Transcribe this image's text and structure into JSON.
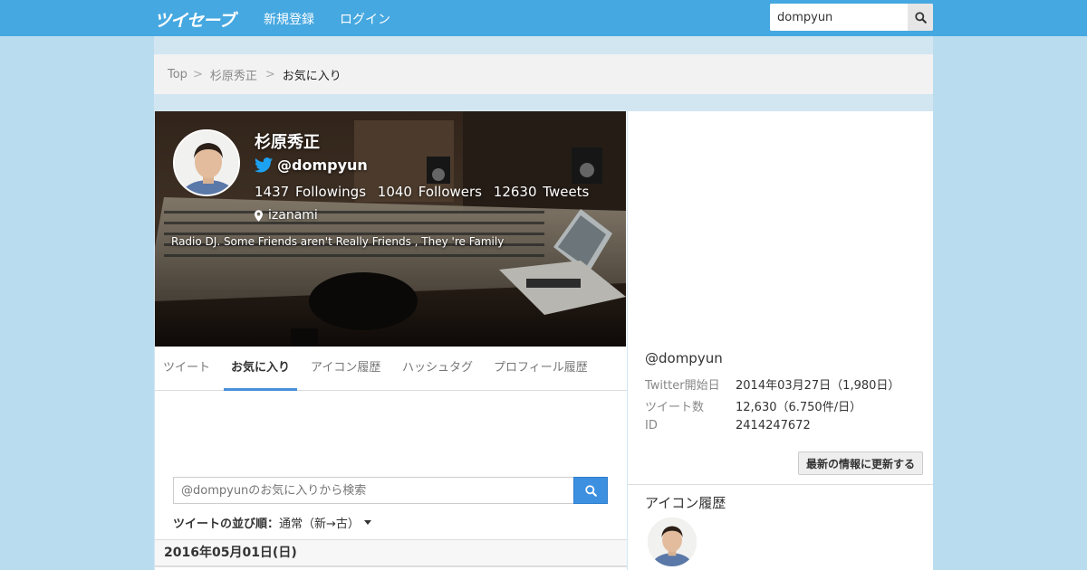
{
  "header": {
    "logo": "ツイセーブ",
    "nav": {
      "signup": "新規登録",
      "login": "ログイン"
    },
    "search": {
      "value": "dompyun"
    }
  },
  "breadcrumb": {
    "items": [
      "Top",
      "杉原秀正"
    ],
    "separator": ">",
    "current": "お気に入り"
  },
  "profile": {
    "name": "杉原秀正",
    "handle": "@dompyun",
    "followings": "1437 Followings",
    "followers": "1040 Followers",
    "tweets": "12630 Tweets",
    "location": "izanami",
    "bio": "Radio DJ. Some Friends aren't Really Friends , They 're Family"
  },
  "tabs": [
    {
      "label": "ツイート"
    },
    {
      "label": "お気に入り"
    },
    {
      "label": "アイコン履歴"
    },
    {
      "label": "ハッシュタグ"
    },
    {
      "label": "プロフィール履歴"
    }
  ],
  "favorites": {
    "search_placeholder": "@dompyunのお気に入りから検索",
    "sort_label": "ツイートの並び順：",
    "sort_value": "通常（新→古）",
    "date_header": "2016年05月01日(日)"
  },
  "sidebar": {
    "handle": "@dompyun",
    "info": [
      {
        "label": "Twitter開始日",
        "value": "2014年03月27日（1,980日）"
      },
      {
        "label": "ツイート数",
        "value": "12,630（6.750件/日）"
      },
      {
        "label": "ID",
        "value": "2414247672"
      }
    ],
    "refresh_label": "最新の情報に更新する",
    "icon_history_title": "アイコン履歴"
  },
  "colors": {
    "topbar": "#46a8e0",
    "page_bg": "#b9dcef",
    "accent": "#4a90d9",
    "twitter_blue": "#1da1f2"
  }
}
